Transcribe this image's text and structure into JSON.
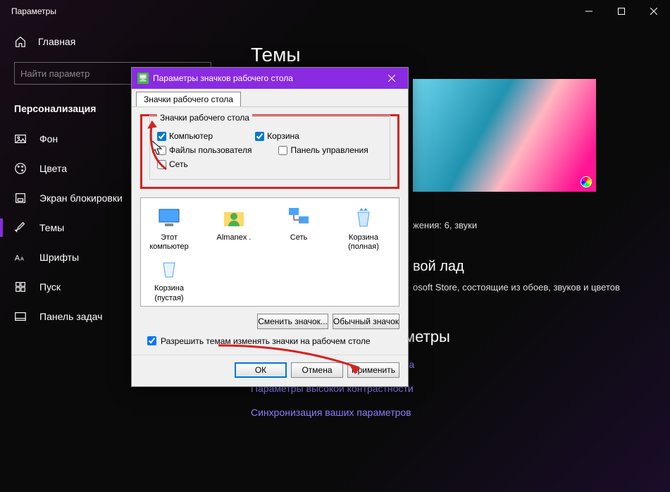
{
  "window_title": "Параметры",
  "home_label": "Главная",
  "search_placeholder": "Найти параметр",
  "section": "Персонализация",
  "nav": [
    {
      "label": "Фон"
    },
    {
      "label": "Цвета"
    },
    {
      "label": "Экран блокировки"
    },
    {
      "label": "Темы"
    },
    {
      "label": "Шрифты"
    },
    {
      "label": "Пуск"
    },
    {
      "label": "Панель задач"
    }
  ],
  "page_title": "Темы",
  "caption_text": "жения: 6, звуки",
  "subhead": "вой лад",
  "body_text": "osoft Store, состоящие из обоев, звуков и цветов",
  "related_head": "Сопутствующие параметры",
  "links": [
    "Параметры значков рабочего стола",
    "Параметры высокой контрастности",
    "Синхронизация ваших параметров"
  ],
  "dialog": {
    "title": "Параметры значков рабочего стола",
    "tab": "Значки рабочего стола",
    "group_title": "Значки рабочего стола",
    "checkboxes": {
      "computer": {
        "label": "Компьютер",
        "checked": true
      },
      "recycle": {
        "label": "Корзина",
        "checked": true
      },
      "userfiles": {
        "label": "Файлы пользователя",
        "checked": false
      },
      "control": {
        "label": "Панель управления",
        "checked": false
      },
      "network": {
        "label": "Сеть",
        "checked": false
      }
    },
    "icons": [
      "Этот компьютер",
      "Almanex .",
      "Сеть",
      "Корзина (полная)",
      "Корзина (пустая)"
    ],
    "btn_change": "Сменить значок...",
    "btn_default": "Обычный значок",
    "allow_themes": "Разрешить темам изменять значки на рабочем столе",
    "btn_ok": "ОК",
    "btn_cancel": "Отмена",
    "btn_apply": "Применить"
  }
}
